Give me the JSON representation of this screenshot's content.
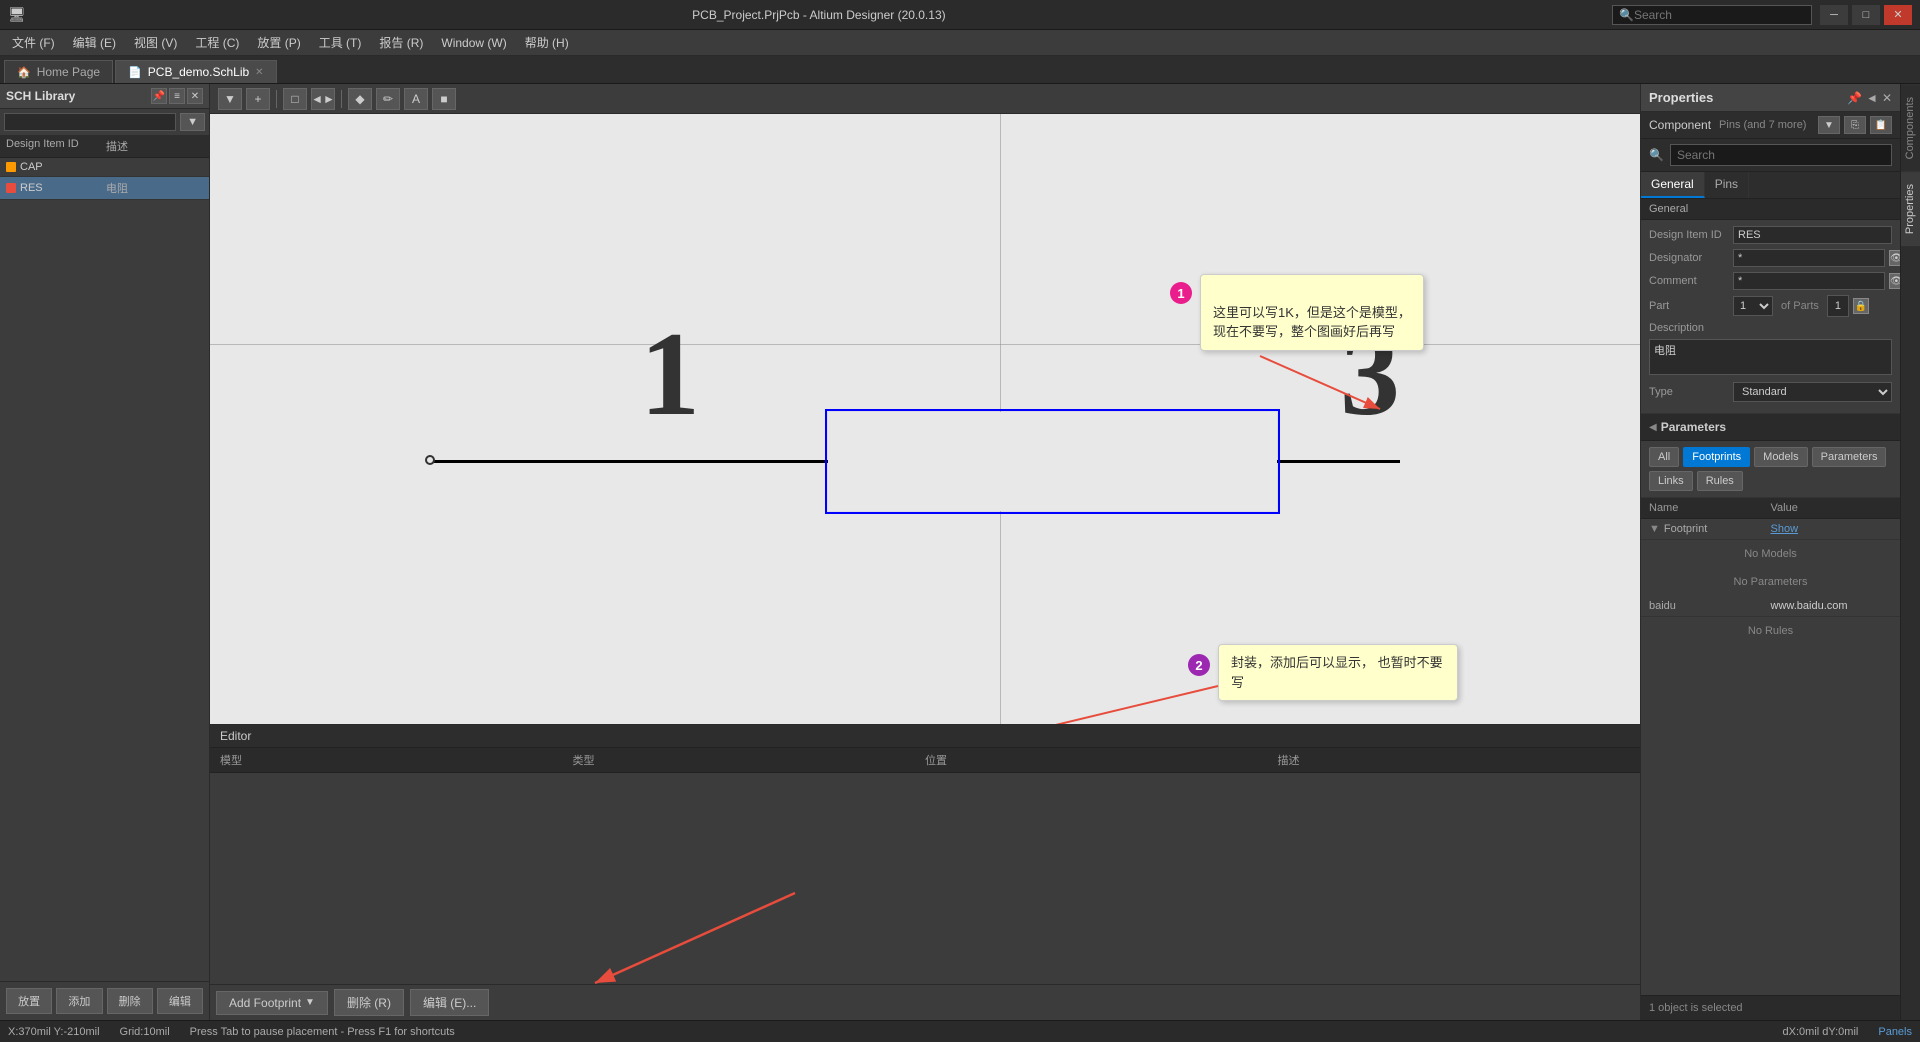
{
  "titlebar": {
    "title": "PCB_Project.PrjPcb - Altium Designer (20.0.13)",
    "search_placeholder": "Search",
    "min_label": "─",
    "max_label": "□",
    "close_label": "✕"
  },
  "menubar": {
    "items": [
      {
        "label": "文件 (F)"
      },
      {
        "label": "编辑 (E)"
      },
      {
        "label": "视图 (V)"
      },
      {
        "label": "工程 (C)"
      },
      {
        "label": "放置 (P)"
      },
      {
        "label": "工具 (T)"
      },
      {
        "label": "报告 (R)"
      },
      {
        "label": "Window (W)"
      },
      {
        "label": "帮助 (H)"
      }
    ]
  },
  "tabs": {
    "items": [
      {
        "label": "Home Page",
        "icon": "🏠",
        "active": false,
        "closable": false
      },
      {
        "label": "PCB_demo.SchLib",
        "icon": "📄",
        "active": true,
        "closable": true
      }
    ]
  },
  "left_panel": {
    "title": "SCH Library",
    "columns": [
      {
        "label": "Design Item ID"
      },
      {
        "label": "描述"
      }
    ],
    "rows": [
      {
        "id": "CAP",
        "desc": "",
        "icon_color": "orange"
      },
      {
        "id": "RES",
        "desc": "电阻",
        "icon_color": "red"
      }
    ],
    "buttons": [
      {
        "label": "放置"
      },
      {
        "label": "添加"
      },
      {
        "label": "删除"
      },
      {
        "label": "编辑"
      }
    ]
  },
  "toolbar": {
    "buttons": [
      "▼",
      "+",
      "□",
      "◄►",
      "◆",
      "✏",
      "A",
      "■"
    ]
  },
  "canvas": {
    "number1": "1",
    "number3": "3",
    "tooltip1": {
      "number": "1",
      "text": "这里可以写1K，但是这个是模型，\n现在不要写，整个图画好后再写"
    },
    "tooltip2": {
      "number": "2",
      "text": "封装，添加后可以显示，\n也暂时不要写"
    }
  },
  "editor_panel": {
    "title": "Editor",
    "columns": [
      {
        "label": "模型"
      },
      {
        "label": "类型"
      },
      {
        "label": "位置"
      },
      {
        "label": "描述"
      }
    ]
  },
  "bottom_buttons": [
    {
      "label": "Add Footprint",
      "has_dropdown": true
    },
    {
      "label": "删除 (R)"
    },
    {
      "label": "编辑 (E)..."
    }
  ],
  "statusbar": {
    "coords": "X:370mil  Y:-210mil",
    "grid": "Grid:10mil",
    "message": "Press Tab to pause placement - Press F1 for shortcuts",
    "dx": "dX:0mil dY:0mil",
    "panel": "Panels"
  },
  "properties_panel": {
    "title": "Properties",
    "component_label": "Component",
    "pins_label": "Pins (and 7 more)",
    "search_placeholder": "Search",
    "tabs": [
      {
        "label": "General",
        "active": true
      },
      {
        "label": "Pins",
        "active": false
      }
    ],
    "general_tab_label": "General",
    "fields": {
      "design_item_id_label": "Design Item ID",
      "design_item_id_value": "RES",
      "designator_label": "Designator",
      "designator_value": "*",
      "comment_label": "Comment",
      "comment_value": "*",
      "part_label": "Part",
      "part_value": "1",
      "of_parts": "of Parts",
      "parts_count": "1",
      "description_label": "Description",
      "description_value": "电阻",
      "type_label": "Type",
      "type_value": "Standard"
    },
    "parameters_section": {
      "title": "Parameters",
      "buttons": [
        {
          "label": "All",
          "active": false
        },
        {
          "label": "Footprints",
          "active": true
        },
        {
          "label": "Models",
          "active": false
        },
        {
          "label": "Parameters",
          "active": false
        },
        {
          "label": "Links",
          "active": false
        },
        {
          "label": "Rules",
          "active": false
        }
      ],
      "table_columns": [
        {
          "label": "Name"
        },
        {
          "label": "Value"
        }
      ],
      "rows": [
        {
          "name": "Footprint",
          "value": "",
          "has_expand": true,
          "has_show": true,
          "show_label": "Show"
        },
        {
          "name": "No Models",
          "value": "",
          "is_empty": true
        },
        {
          "name": "No Parameters",
          "value": "",
          "is_empty": true
        },
        {
          "name": "baidu",
          "value": "www.baidu.com",
          "is_empty": false
        },
        {
          "name": "No Rules",
          "value": "",
          "is_empty": true
        }
      ]
    },
    "bottom_status": "1 object is selected"
  },
  "far_right_tabs": [
    {
      "label": "Components"
    },
    {
      "label": "Properties"
    }
  ]
}
